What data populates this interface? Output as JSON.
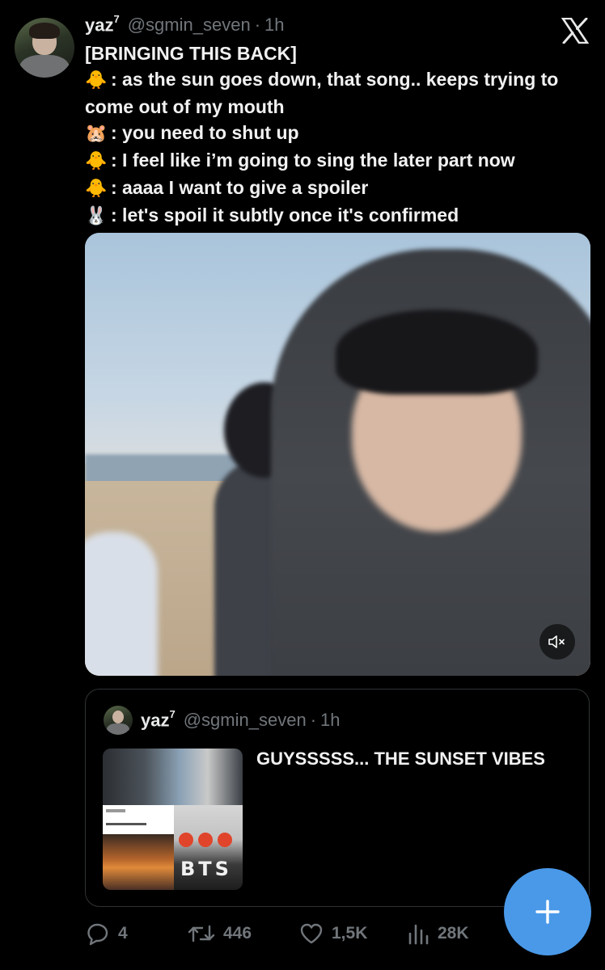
{
  "author": {
    "display_name": "yaz",
    "superscript": "7",
    "handle": "@sgmin_seven",
    "separator": "·",
    "time": "1h"
  },
  "tweet": {
    "lines": [
      {
        "emoji": "",
        "text": "[BRINGING THIS BACK]"
      },
      {
        "emoji": "🐥",
        "text": ": as the sun goes down, that song.. keeps trying to come out of my mouth"
      },
      {
        "emoji": "🐹",
        "text": ": you need to shut up"
      },
      {
        "emoji": "🐥",
        "text": ": I feel like i’m going to sing the later part now"
      },
      {
        "emoji": "🐥",
        "text": ": aaaa I want to give a spoiler"
      },
      {
        "emoji": "🐰",
        "text": ": let's spoil it subtly once it's confirmed"
      }
    ]
  },
  "media": {
    "type": "video",
    "mute_icon": "speaker-muted-icon"
  },
  "quote": {
    "display_name": "yaz",
    "superscript": "7",
    "handle": "@sgmin_seven",
    "separator": "·",
    "time": "1h",
    "text": "GUYSSSSS... THE SUNSET VIBES",
    "thumb_label": "BTS"
  },
  "actions": {
    "replies": "4",
    "retweets": "446",
    "likes": "1,5K",
    "views": "28K"
  },
  "colors": {
    "background": "#000000",
    "text": "#e7e9ea",
    "muted": "#71767b",
    "accent": "#4a99e9",
    "border": "#2f3336"
  },
  "icons": [
    "x-logo-icon",
    "reply-icon",
    "retweet-icon",
    "heart-icon",
    "views-icon",
    "plus-icon",
    "speaker-muted-icon"
  ]
}
